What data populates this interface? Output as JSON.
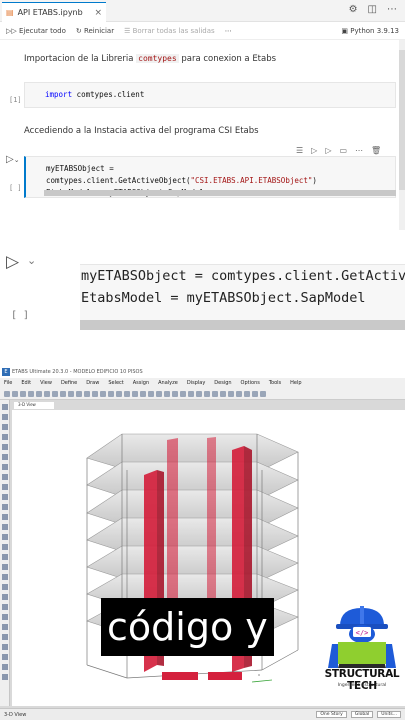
{
  "notebook": {
    "tab_title": "API ETABS.ipynb",
    "toolbar": {
      "run_all": "Ejecutar todo",
      "restart": "Reiniciar",
      "clear_outputs": "Borrar todas las salidas",
      "kernel": "Python 3.9.13"
    },
    "cells": [
      {
        "type": "markdown",
        "text_before": "Importacion de la Libreria ",
        "code": "comtypes",
        "text_after": " para conexion a Etabs"
      },
      {
        "type": "code",
        "index": "[1]",
        "line1_kw": "import",
        "line1_rest": " comtypes.client"
      },
      {
        "type": "markdown",
        "text": "Accediendo a la Instacia activa del programa CSI Etabs"
      },
      {
        "type": "code",
        "index": "[ ]",
        "line1_pre": "myETABSObject = comtypes.client.GetActiveObject(",
        "line1_str": "\"CSI.ETABS.API.ETABSObject\"",
        "line1_post": ")",
        "line2": "EtabsModel = myETABSObject.SapModel"
      }
    ]
  },
  "zoom": {
    "index": "[ ]",
    "line1": "myETABSObject = comtypes.client.GetActiveObject(",
    "line2": "EtabsModel = myETABSObject.SapModel"
  },
  "etabs": {
    "title": "ETABS Ultimate 20.3.0 - MODELO EDIFICIO 10 PISOS",
    "menu": [
      "File",
      "Edit",
      "View",
      "Define",
      "Draw",
      "Select",
      "Assign",
      "Analyze",
      "Display",
      "Design",
      "Options",
      "Tools",
      "Help"
    ],
    "view_tab": "3-D View",
    "status_left": "3-D View",
    "status_story": "One Story",
    "status_coord": "Global",
    "status_units": "Units..."
  },
  "caption": "código y",
  "brand": {
    "name": "STRUCTURAL TECH",
    "tagline": "Ingenieria Estructural",
    "colors": {
      "helmet": "#1e5bd8",
      "screen": "#8fcf2f",
      "bracket": "#c93b9c"
    }
  },
  "colors": {
    "accent": "#007acc",
    "column_red": "#d4213d",
    "keyword": "#0000ff",
    "string": "#a31515"
  }
}
